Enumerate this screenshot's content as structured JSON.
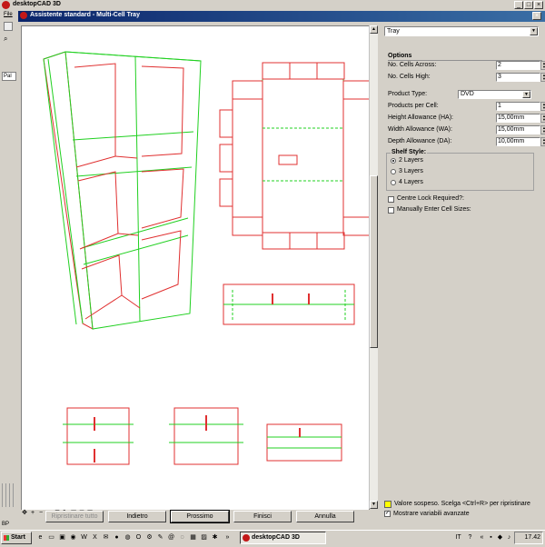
{
  "app": {
    "title": "desktopCAD 3D",
    "menu_file": "File",
    "side_tab": "Pal",
    "status_label": "BP"
  },
  "dialog": {
    "title": "Assistente standard - Multi-Cell Tray"
  },
  "panel": {
    "template_select": "Tray",
    "options_title": "Options",
    "fields": [
      {
        "label": "No. Cells Across:",
        "value": "2"
      },
      {
        "label": "No. Cells High:",
        "value": "3"
      },
      {
        "label": "Product Type:",
        "value": "DVD"
      },
      {
        "label": "Products per Cell:",
        "value": "1"
      },
      {
        "label": "Height Allowance (HA):",
        "value": "15,00mm"
      },
      {
        "label": "Width Allowance (WA):",
        "value": "15,00mm"
      },
      {
        "label": "Depth Allowance (DA):",
        "value": "10,00mm"
      }
    ],
    "shelf_title": "Shelf Style:",
    "shelf_options": [
      {
        "label": "2 Layers",
        "selected": true
      },
      {
        "label": "3 Layers",
        "selected": false
      },
      {
        "label": "4 Layers",
        "selected": false
      }
    ],
    "centre_lock": {
      "label": "Centre Lock Required?:",
      "checked": false
    },
    "manual_sizes": {
      "label": "Manually Enter Cell Sizes:",
      "checked": false
    },
    "footer_note": "Valore sospeso. Scelga <Ctrl+R> per ripristinare",
    "advanced": {
      "label": "Mostrare variabili avanzate",
      "checked": true
    }
  },
  "buttons": {
    "reset": "Ripristinare tutto",
    "back": "Indietro",
    "next": "Prossimo",
    "finish": "Finisci",
    "cancel": "Annulla"
  },
  "taskbar": {
    "start": "Start",
    "task": "desktopCAD 3D",
    "clock": "17.42"
  },
  "colors": {
    "cut_line": "#e03030",
    "crease_line": "#20d020",
    "title_bar": "#0a246a",
    "warning_swatch": "#ffff00"
  }
}
